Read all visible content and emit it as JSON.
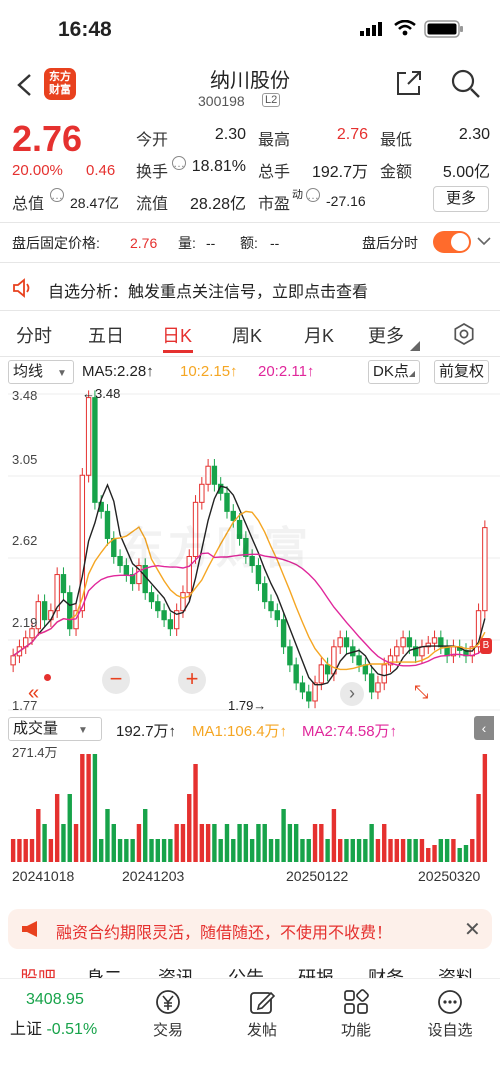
{
  "status": {
    "time": "16:48"
  },
  "header": {
    "logo_line1": "东方",
    "logo_line2": "财富",
    "name": "纳川股份",
    "code": "300198",
    "level": "L2"
  },
  "quote": {
    "price": "2.76",
    "change_pct": "20.00%",
    "change": "0.46",
    "open_label": "今开",
    "open": "2.30",
    "high_label": "最高",
    "high": "2.76",
    "low_label": "最低",
    "low": "2.30",
    "turnover_label": "换手",
    "turnover": "18.81%",
    "volume_label": "总手",
    "volume": "192.7万",
    "amount_label": "金额",
    "amount": "5.00亿",
    "mktcap_label": "总值",
    "mktcap": "28.47亿",
    "float_label": "流值",
    "float": "28.28亿",
    "pe_label": "市盈",
    "pe_sup": "动",
    "pe": "-27.16",
    "more": "更多"
  },
  "after_hours": {
    "label": "盘后固定价格:",
    "price": "2.76",
    "vol_label": "量:",
    "vol": "--",
    "amt_label": "额:",
    "amt": "--",
    "timeshare": "盘后分时",
    "enabled": true
  },
  "notice": {
    "text": "自选分析：触发重点关注信号，立即点击查看"
  },
  "tabs": [
    {
      "label": "分时"
    },
    {
      "label": "五日"
    },
    {
      "label": "日K"
    },
    {
      "label": "周K"
    },
    {
      "label": "月K"
    },
    {
      "label": "更多"
    }
  ],
  "active_tab": "日K",
  "ma_bar": {
    "indicator": "均线",
    "ma5": "MA5:2.28↑",
    "ma10": "10:2.15↑",
    "ma20": "20:2.11↑",
    "dk": "DK点",
    "adjust": "前复权"
  },
  "colors": {
    "up": "#e5312f",
    "down": "#17a34a",
    "ma5": "#222222",
    "ma10": "#f5a623",
    "ma20": "#e0279b",
    "accent": "#ff6b2c"
  },
  "price_axis": {
    "top": "3.48",
    "mid1": "3.05",
    "mid2": "2.62",
    "mid3": "2.19",
    "bottom": "1.77"
  },
  "annotations": {
    "max": "←3.48",
    "min": "1.79→"
  },
  "watermark": "东方财富",
  "vol_bar": {
    "indicator": "成交量",
    "vol": "192.7万↑",
    "ma1": "MA1:106.4万↑",
    "ma2": "MA2:74.58万↑",
    "axis_max": "271.4万"
  },
  "dates": [
    "20241018",
    "20241203",
    "20250122",
    "20250320"
  ],
  "promo": {
    "text": "融资合约期限灵活，随借随还，不使用不收费！"
  },
  "feature_tabs": [
    "股吧",
    "身二",
    "资讯",
    "公告",
    "研报",
    "财务",
    "资料"
  ],
  "bottom": {
    "index_value": "3408.95",
    "index_name": "上证",
    "index_change": "-0.51%",
    "items": [
      {
        "label": "交易",
        "icon": "yen-icon"
      },
      {
        "label": "发帖",
        "icon": "edit-icon"
      },
      {
        "label": "功能",
        "icon": "grid-icon"
      },
      {
        "label": "设自选",
        "icon": "more-icon"
      }
    ]
  }
}
